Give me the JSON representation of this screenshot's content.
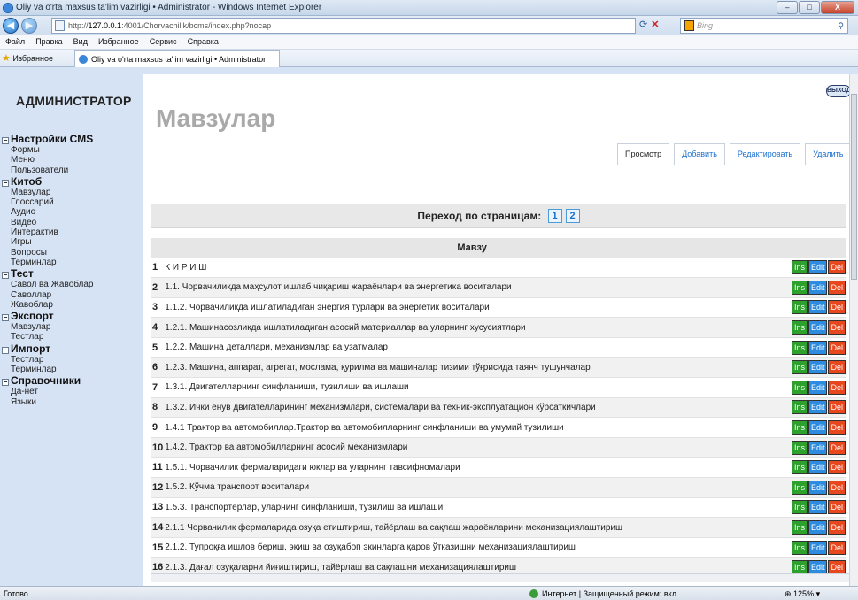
{
  "window": {
    "title": "Oliy va o'rta maxsus ta'lim vazirligi • Administrator - Windows Internet Explorer",
    "buttons": [
      "–",
      "□",
      "X"
    ]
  },
  "address": {
    "url_prefix": "http://",
    "url_host": "127.0.0.1",
    "url_rest": ":4001/Chorvachilik/bcms/index.php?nocap",
    "search_placeholder": "Bing"
  },
  "menubar": [
    "Файл",
    "Правка",
    "Вид",
    "Избранное",
    "Сервис",
    "Справка"
  ],
  "favorites": {
    "label": "Избранное",
    "tab_title": "Oliy va o'rta maxsus ta'lim vazirligi • Administrator"
  },
  "sidebar": {
    "admin_label": "АДМИНИСТРАТОР",
    "groups": [
      {
        "title": "Настройки CMS",
        "items": [
          "Формы",
          "Меню",
          "Пользователи"
        ]
      },
      {
        "title": "Китоб",
        "items": [
          "Мавзулар",
          "Глоссарий",
          "Аудио",
          "Видео",
          "Интерактив",
          "Игры",
          "Вопросы",
          "Терминлар"
        ]
      },
      {
        "title": "Тест",
        "items": [
          "Савол ва Жавоблар",
          "Саволлар",
          "Жавоблар"
        ]
      },
      {
        "title": "Экспорт",
        "items": [
          "Мавзулар",
          "Тестлар"
        ]
      },
      {
        "title": "Импорт",
        "items": [
          "Тестлар",
          "Терминлар"
        ]
      },
      {
        "title": "Справочники",
        "items": [
          "Да-нет",
          "Языки"
        ]
      }
    ]
  },
  "main": {
    "exit_label": "ВЫХОД",
    "page_title": "Мавзулар",
    "tabs": [
      "Просмотр",
      "Добавить",
      "Редактировать",
      "Удалить"
    ],
    "pager_label": "Переход по страницам:",
    "pages": [
      "1",
      "2"
    ],
    "table_header": "Мавзу",
    "action_labels": {
      "ins": "Ins",
      "edit": "Edit",
      "del": "Del"
    },
    "rows": [
      {
        "n": "1",
        "title": "К И Р И Ш"
      },
      {
        "n": "2",
        "title": "1.1. Чорвачиликда маҳсулот ишлаб чиқариш жараёнлари ва энергетика воситалари"
      },
      {
        "n": "3",
        "title": "1.1.2. Чорвачиликда ишлатиладиган энергия турлари ва энергетик воситалари"
      },
      {
        "n": "4",
        "title": "1.2.1. Машинасозликда ишлатиладиган асосий материаллар ва уларнинг хусусиятлари"
      },
      {
        "n": "5",
        "title": "1.2.2. Машина деталлари, механизмлар ва узатмалар"
      },
      {
        "n": "6",
        "title": "1.2.3. Машина, аппарат, агрегат, мослама, қурилма ва машиналар тизими тўғрисида таянч тушунчалар"
      },
      {
        "n": "7",
        "title": "1.3.1. Двигателларнинг синфланиши, тузилиши ва ишлаши"
      },
      {
        "n": "8",
        "title": "1.3.2. Ички ёнув двигателларининг механизмлари, системалари ва техник-эксплуатацион кўрсаткичлари"
      },
      {
        "n": "9",
        "title": "1.4.1 Трактор ва автомобиллар.Трактор ва автомобилларнинг синфланиши ва умумий тузилиши"
      },
      {
        "n": "10",
        "title": "1.4.2. Трактор ва автомобилларнинг асосий механизмлари"
      },
      {
        "n": "11",
        "title": "1.5.1. Чорвачилик фермаларидаги юклар ва уларнинг тавсифномалари"
      },
      {
        "n": "12",
        "title": "1.5.2. Кўчма транспорт воситалари"
      },
      {
        "n": "13",
        "title": "1.5.3. Транспортёрлар, уларнинг синфланиши, тузилиш ва ишлаши"
      },
      {
        "n": "14",
        "title": "2.1.1 Чорвачилик фермаларида озуқа етиштириш, тайёрлаш ва сақлаш жараёнларини механизациялаштириш"
      },
      {
        "n": "15",
        "title": "2.1.2. Тупроқға ишлов бериш, экиш ва озуқабоп экинларга қаров ўтказишни механизациялаштириш"
      },
      {
        "n": "16",
        "title": "2.1.3. Дағал озуқаларни йиғиштириш, тайёрлаш ва сақлашни механизациялаштириш"
      }
    ]
  },
  "status": {
    "ready": "Готово",
    "zone": "Интернет | Защищенный режим: вкл.",
    "zoom": "125%"
  }
}
